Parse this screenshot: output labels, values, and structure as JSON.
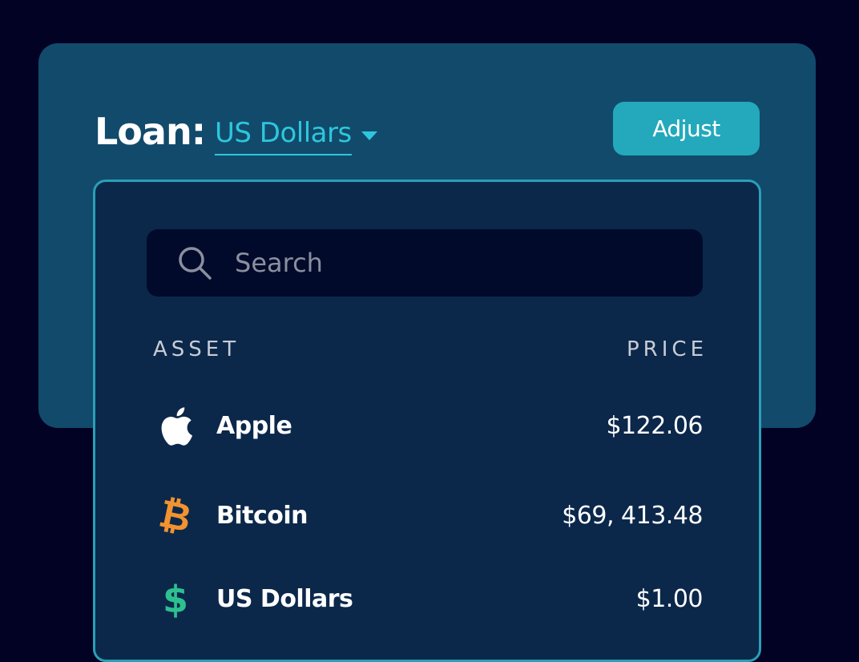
{
  "loan": {
    "label": "Loan:",
    "selected_currency": "US Dollars"
  },
  "adjust_button": {
    "label": "Adjust"
  },
  "dropdown": {
    "search": {
      "placeholder": "Search",
      "value": ""
    },
    "columns": {
      "asset": "ASSET",
      "price": "PRICE"
    },
    "assets": [
      {
        "name": "Apple",
        "price": "$122.06",
        "icon": "apple-icon"
      },
      {
        "name": "Bitcoin",
        "price": "$69, 413.48",
        "icon": "bitcoin-icon"
      },
      {
        "name": "US Dollars",
        "price": "$1.00",
        "icon": "dollar-icon"
      }
    ]
  },
  "colors": {
    "background": "#010224",
    "card": "#124a6b",
    "accent": "#2ec6dc",
    "button": "#23a9bb",
    "dropdown": "#0b284b",
    "bitcoin": "#f3922e",
    "dollar": "#2cc18f"
  }
}
